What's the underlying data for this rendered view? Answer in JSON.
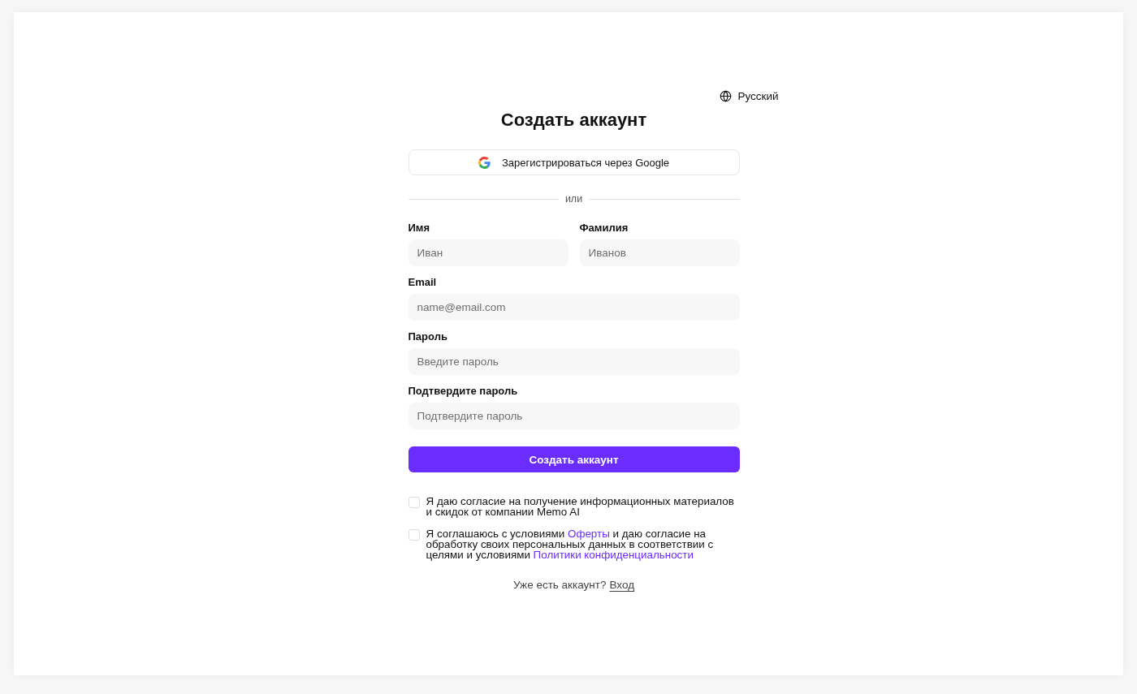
{
  "language": {
    "label": "Русский"
  },
  "title": "Создать аккаунт",
  "google_button": {
    "label": "Зарегистрироваться через Google"
  },
  "divider": {
    "label": "или"
  },
  "name_fields": [
    {
      "label": "Имя",
      "placeholder": "Иван"
    },
    {
      "label": "Фамилия",
      "placeholder": "Иванов"
    }
  ],
  "fields": [
    {
      "label": "Email",
      "placeholder": "name@email.com"
    },
    {
      "label": "Пароль",
      "placeholder": "Введите пароль"
    },
    {
      "label": "Подтвердите пароль",
      "placeholder": "Подтвердите пароль"
    }
  ],
  "submit_button": {
    "label": "Создать аккаунт"
  },
  "consents": [
    {
      "checked": false,
      "parts": [
        {
          "kind": "text",
          "text": "Я даю согласие на получение информационных материалов и скидок от компании Memo AI"
        }
      ]
    },
    {
      "checked": false,
      "parts": [
        {
          "kind": "text",
          "text": "Я соглашаюсь с условиями "
        },
        {
          "kind": "link",
          "text": "Оферты"
        },
        {
          "kind": "text",
          "text": " и даю согласие на обработку своих персональных данных в соответствии с целями и условиями "
        },
        {
          "kind": "link",
          "text": "Политики конфиденциальности"
        }
      ]
    }
  ],
  "login": {
    "question": "Уже есть аккаунт?",
    "link": "Вход"
  }
}
